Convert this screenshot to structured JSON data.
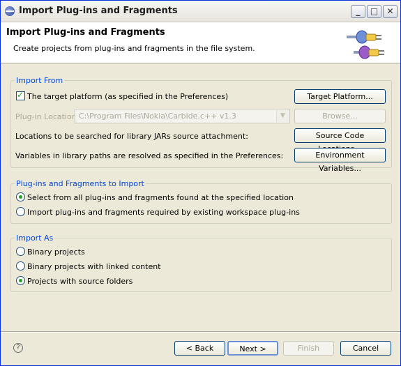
{
  "window": {
    "title": "Import Plug-ins and Fragments"
  },
  "header": {
    "title": "Import Plug-ins and Fragments",
    "description": "Create projects from plug-ins and fragments in the file system."
  },
  "import_from": {
    "legend": "Import From",
    "target_platform_label": "The target platform (as specified in the Preferences)",
    "target_platform_checked": true,
    "target_platform_button": "Target Platform...",
    "plugin_location_label": "Plug-in Location:",
    "plugin_location_value": "C:\\Program Files\\Nokia\\Carbide.c++ v1.3",
    "browse_button": "Browse...",
    "source_locations_label": "Locations to be searched for library JARs source attachment:",
    "source_locations_button": "Source Code Locations...",
    "variables_label": "Variables in library paths are resolved as specified in the Preferences:",
    "environment_button": "Environment Variables..."
  },
  "to_import": {
    "legend": "Plug-ins and Fragments to Import",
    "options": [
      "Select from all plug-ins and fragments found at the specified location",
      "Import plug-ins and fragments required by existing workspace plug-ins"
    ],
    "selected": 0
  },
  "import_as": {
    "legend": "Import As",
    "options": [
      "Binary projects",
      "Binary projects with linked content",
      "Projects with source folders"
    ],
    "selected": 2
  },
  "footer": {
    "help": "?",
    "back": "< Back",
    "next": "Next >",
    "finish": "Finish",
    "cancel": "Cancel"
  }
}
